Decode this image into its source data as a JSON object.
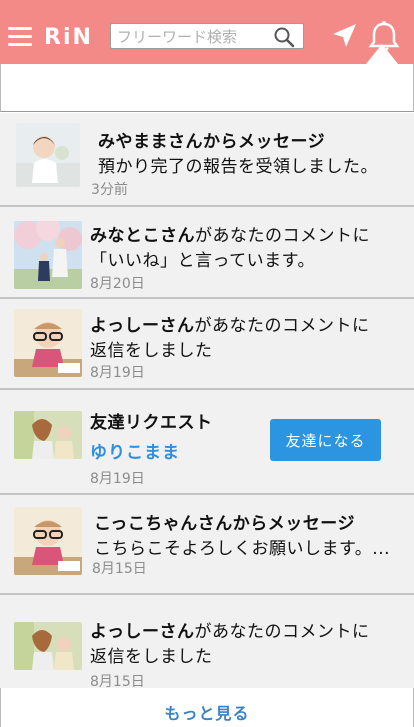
{
  "header": {
    "logo_text": "RiN",
    "search_placeholder": "フリーワード検索",
    "brand_color": "#f48a88"
  },
  "notifications": [
    {
      "title": "みやままさんからメッセージ",
      "body": "預かり完了の報告を受領しました。",
      "date": "3分前"
    },
    {
      "name": "みなとこさん",
      "text_rest": "があなたのコメントに",
      "line2": "「いいね」と言っています。",
      "date": "8月20日"
    },
    {
      "name": "よっしーさん",
      "text_rest": "があなたのコメントに",
      "line2": "返信をしました",
      "date": "8月19日"
    },
    {
      "title": "友達リクエスト",
      "friend_name": "ゆりこまま",
      "button": "友達になる",
      "date": "8月19日"
    },
    {
      "title": "こっこちゃんさんからメッセージ",
      "body": "こちらこそよろしくお願いします。...",
      "date": "8月15日"
    },
    {
      "name": "よっしーさん",
      "text_rest": "があなたのコメントに",
      "line2": "返信をしました",
      "date": "8月15日"
    }
  ],
  "more_label": "もっと見る",
  "colors": {
    "accent_blue": "#2b95e2",
    "link_blue": "#3b82c8",
    "date_gray": "#8c8c8c"
  }
}
